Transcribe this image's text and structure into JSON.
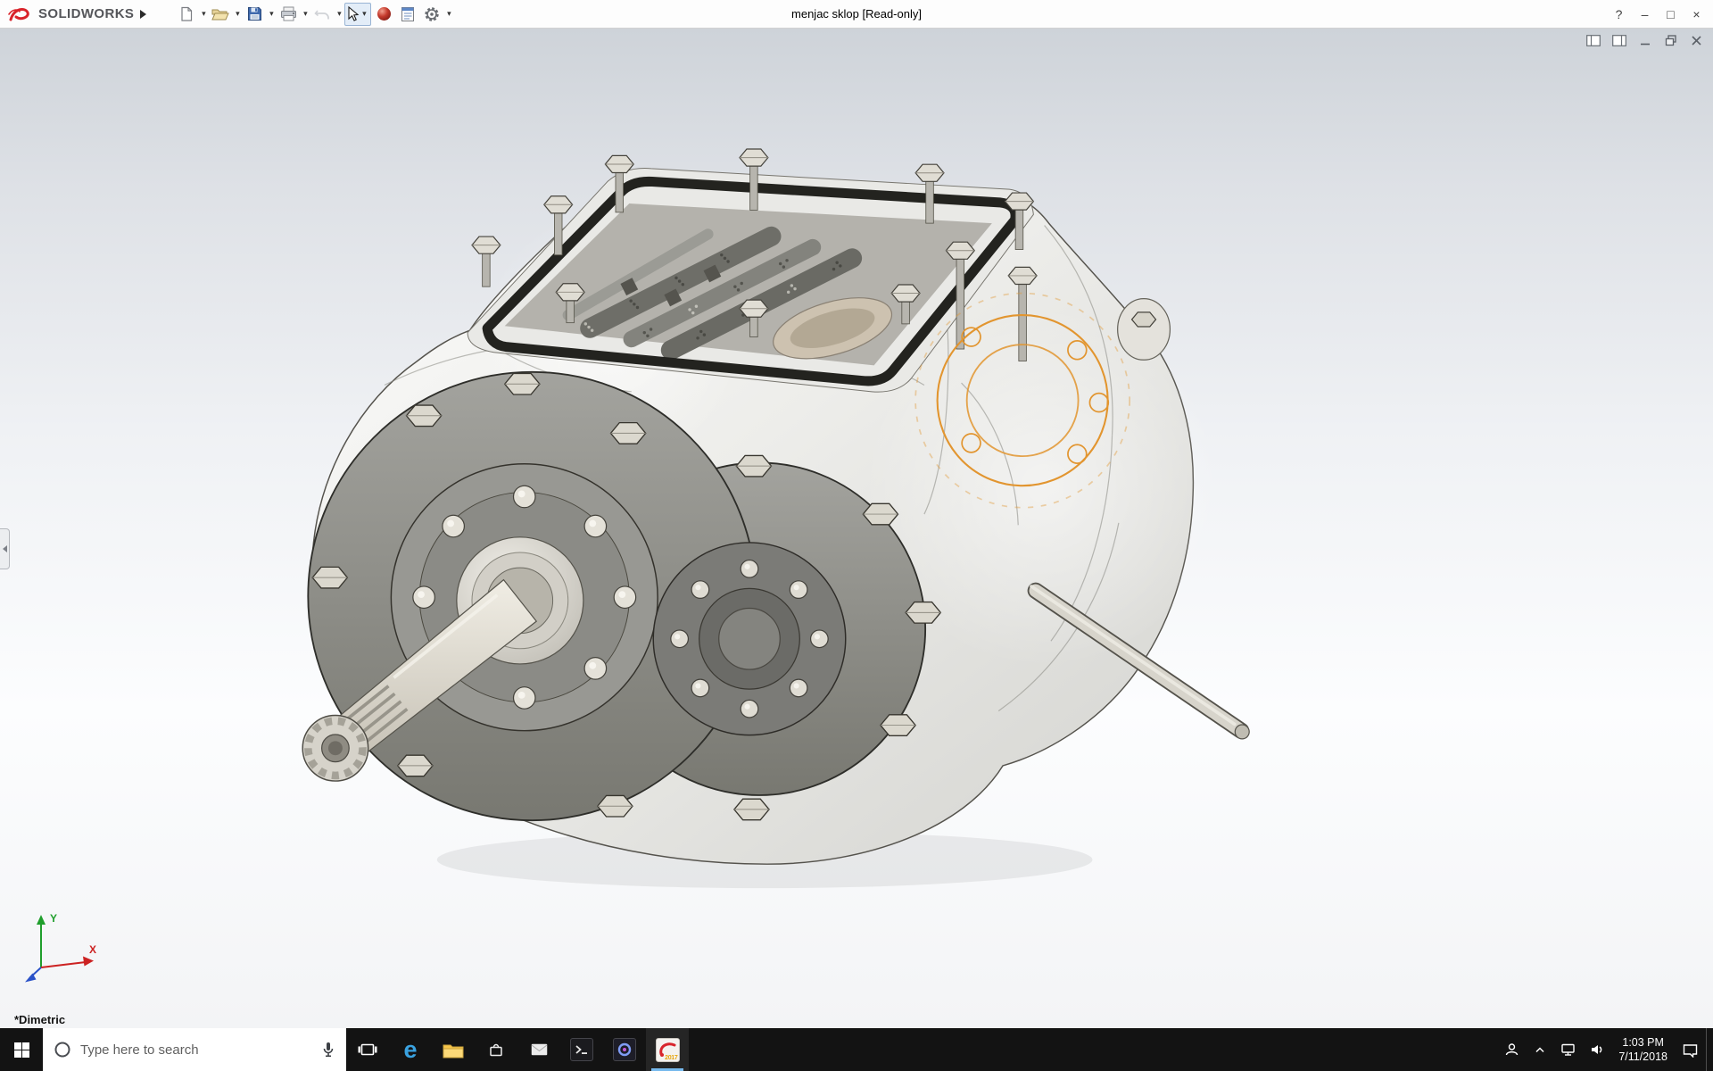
{
  "titlebar": {
    "logo_text": "SOLIDWORKS",
    "document_title": "menjac sklop [Read-only]",
    "help_glyph": "?",
    "minimize_glyph": "–",
    "maximize_glyph": "□",
    "close_glyph": "×"
  },
  "toolbar": {
    "dropdown_glyph": "▾",
    "icons": [
      {
        "name": "new-document-icon"
      },
      {
        "name": "open-folder-icon"
      },
      {
        "name": "save-icon"
      },
      {
        "name": "print-icon"
      },
      {
        "name": "undo-icon"
      },
      {
        "name": "select-cursor-icon"
      },
      {
        "name": "edit-appearance-icon"
      },
      {
        "name": "document-properties-icon"
      },
      {
        "name": "options-gear-icon"
      }
    ]
  },
  "viewport": {
    "view_orientation_label": "*Dimetric",
    "triad": {
      "x_label": "X",
      "y_label": "Y"
    },
    "doc_window_icons": [
      "pane-left-icon",
      "pane-right-icon",
      "minimize-icon",
      "restore-icon",
      "close-icon"
    ],
    "selection_color": "#e2952f"
  },
  "taskbar": {
    "search_placeholder": "Type here to search",
    "time": "1:03 PM",
    "date": "7/11/2018",
    "edge_glyph": "e",
    "solidworks_badge": "2017",
    "icon_names": [
      "start-icon",
      "cortana-circle-icon",
      "microphone-icon",
      "task-view-icon",
      "edge-icon",
      "file-explorer-icon",
      "store-icon",
      "mail-icon",
      "console-app-icon",
      "media-app-icon",
      "solidworks-app-icon",
      "people-icon",
      "hidden-icons-chevron-icon",
      "network-icon",
      "volume-icon",
      "action-center-icon"
    ]
  },
  "colors": {
    "brand_red": "#d9232a",
    "taskbar_bg": "#131313",
    "selection_orange": "#e2952f",
    "viewport_gradient_top": "#ced3d9",
    "viewport_gradient_bottom": "#f3f4f6"
  }
}
